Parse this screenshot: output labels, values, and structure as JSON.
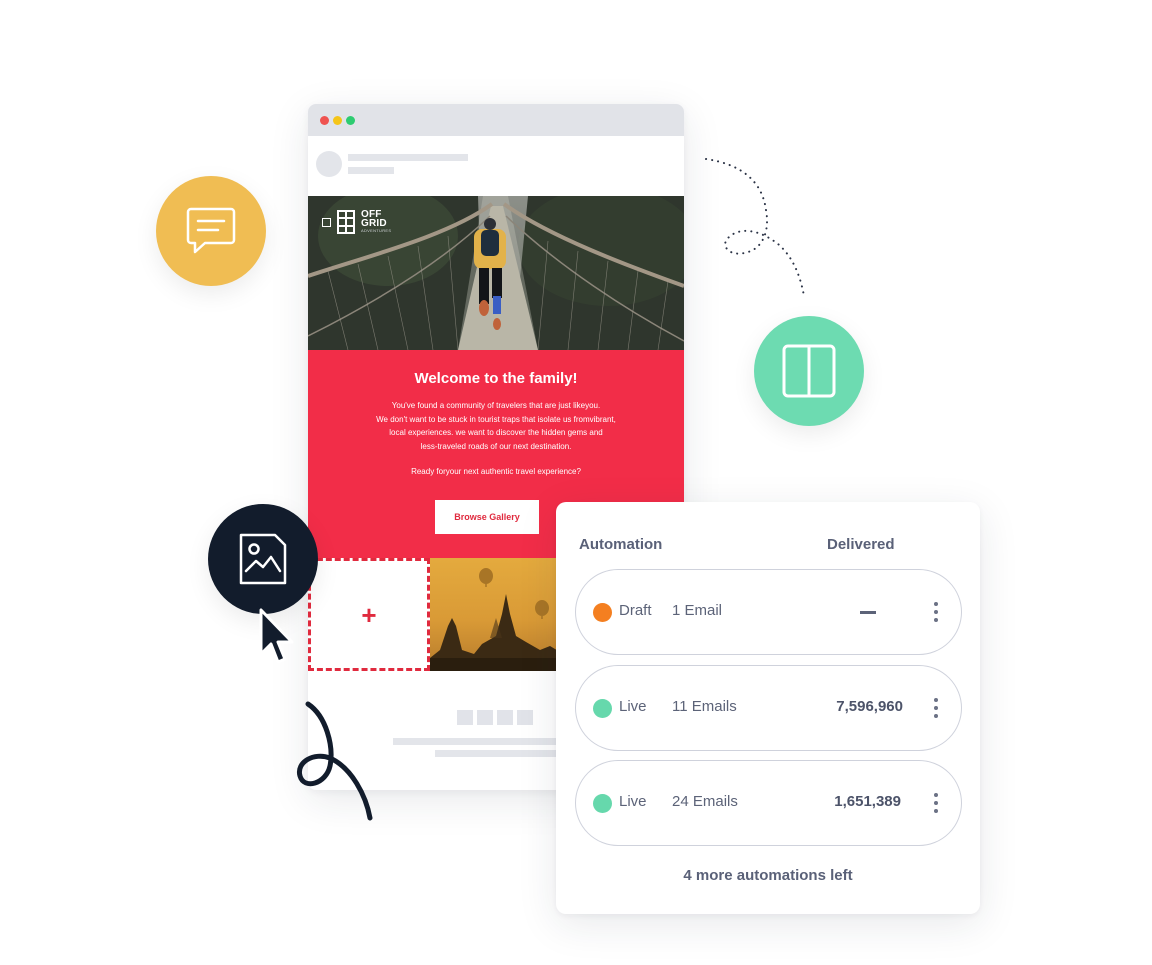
{
  "email_preview": {
    "window_controls": [
      "close",
      "minimize",
      "maximize"
    ],
    "window_colors": {
      "close": "#ef5350",
      "minimize": "#f5c518",
      "maximize": "#2ecc71"
    },
    "logo": {
      "line1": "OFF",
      "line2": "GRID",
      "subtitle": "ADVENTURES"
    },
    "promo": {
      "title": "Welcome to the family!",
      "body_lines": [
        "You've found a community of travelers that are just likeyou.",
        "We don't want to be stuck in tourist traps that isolate us fromvibrant,",
        "local experiences.  we want to discover the hidden gems and",
        "less-traveled roads of our next destination."
      ],
      "question": "Ready foryour next authentic travel experience?",
      "button_label": "Browse Gallery",
      "background_color": "#f22d48"
    },
    "drop_zone_symbol": "+"
  },
  "floating_icons": {
    "chat": {
      "icon": "chat-bubble-icon",
      "color": "#f0bd53"
    },
    "layout": {
      "icon": "two-column-layout-icon",
      "color": "#6ddbb1"
    },
    "image": {
      "icon": "image-file-icon",
      "color": "#121c2c"
    }
  },
  "automation_card": {
    "headers": {
      "automation": "Automation",
      "delivered": "Delivered"
    },
    "rows": [
      {
        "status": "Draft",
        "status_color": "#f47f20",
        "emails": "1 Email",
        "delivered": "—"
      },
      {
        "status": "Live",
        "status_color": "#66d8ac",
        "emails": "11 Emails",
        "delivered": "7,596,960"
      },
      {
        "status": "Live",
        "status_color": "#66d8ac",
        "emails": "24 Emails",
        "delivered": "1,651,389"
      }
    ],
    "more_link": "4 more automations left"
  }
}
